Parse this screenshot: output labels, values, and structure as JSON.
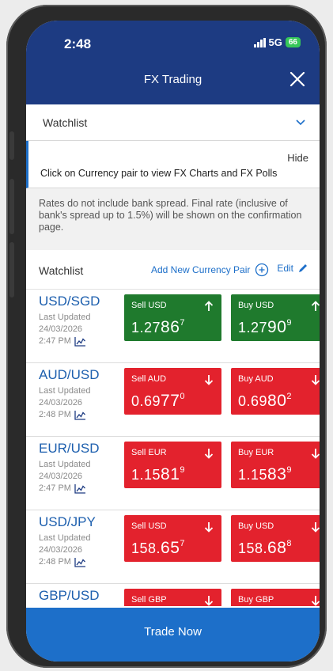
{
  "status": {
    "time": "2:48",
    "network": "5G",
    "battery": "66"
  },
  "header": {
    "title": "FX Trading"
  },
  "watchlist_dropdown": {
    "label": "Watchlist"
  },
  "info": {
    "hide": "Hide",
    "message": "Click on Currency pair to view FX Charts and FX Polls"
  },
  "disclaimer": "Rates do not include bank spread. Final rate (inclusive of bank's spread up to 1.5%) will be shown on the confirmation page.",
  "watchlist": {
    "label": "Watchlist",
    "add": "Add New Currency Pair",
    "edit": "Edit"
  },
  "pairs": [
    {
      "name": "USD/SGD",
      "updated_label": "Last Updated",
      "date": "24/03/2026",
      "time": "2:47 PM",
      "sell": {
        "label": "Sell USD",
        "pre": "1.27",
        "big": "86",
        "sup": "7",
        "direction": "up"
      },
      "buy": {
        "label": "Buy USD",
        "pre": "1.27",
        "big": "90",
        "sup": "9",
        "direction": "up"
      }
    },
    {
      "name": "AUD/USD",
      "updated_label": "Last Updated",
      "date": "24/03/2026",
      "time": "2:48 PM",
      "sell": {
        "label": "Sell AUD",
        "pre": "0.69",
        "big": "77",
        "sup": "0",
        "direction": "down"
      },
      "buy": {
        "label": "Buy AUD",
        "pre": "0.69",
        "big": "80",
        "sup": "2",
        "direction": "down"
      }
    },
    {
      "name": "EUR/USD",
      "updated_label": "Last Updated",
      "date": "24/03/2026",
      "time": "2:47 PM",
      "sell": {
        "label": "Sell EUR",
        "pre": "1.15",
        "big": "81",
        "sup": "9",
        "direction": "down"
      },
      "buy": {
        "label": "Buy EUR",
        "pre": "1.15",
        "big": "83",
        "sup": "9",
        "direction": "down"
      }
    },
    {
      "name": "USD/JPY",
      "updated_label": "Last Updated",
      "date": "24/03/2026",
      "time": "2:48 PM",
      "sell": {
        "label": "Sell USD",
        "pre": "158.",
        "big": "65",
        "sup": "7",
        "direction": "down"
      },
      "buy": {
        "label": "Buy USD",
        "pre": "158.",
        "big": "68",
        "sup": "8",
        "direction": "down"
      }
    },
    {
      "name": "GBP/USD",
      "updated_label": "",
      "date": "",
      "time": "",
      "sell": {
        "label": "Sell GBP",
        "pre": "",
        "big": "",
        "sup": "",
        "direction": "down"
      },
      "buy": {
        "label": "Buy GBP",
        "pre": "",
        "big": "",
        "sup": "",
        "direction": "down"
      }
    }
  ],
  "trade_button": "Trade Now",
  "colors": {
    "header": "#1d3b82",
    "accent": "#1d6fc9",
    "up": "#1f7a2d",
    "down": "#e3222d"
  },
  "icons": [
    "close-icon",
    "chevron-down-icon",
    "plus-circle-icon",
    "pencil-icon",
    "chart-icon",
    "arrow-up-icon",
    "arrow-down-icon"
  ]
}
